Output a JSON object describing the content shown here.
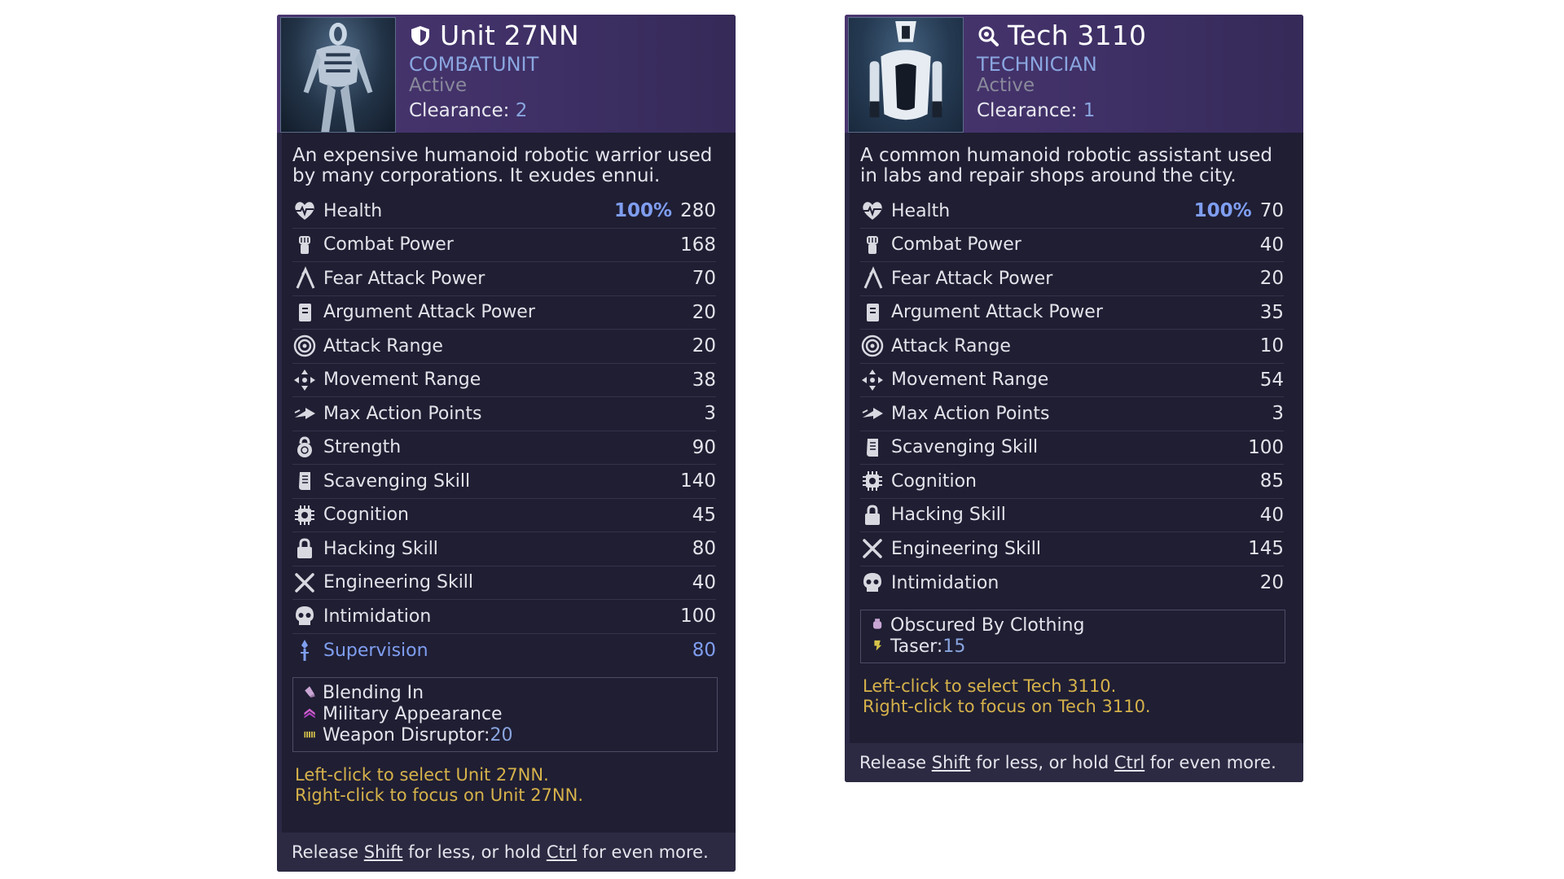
{
  "cards": [
    {
      "title": "Unit 27NN",
      "title_icon": "shield-icon",
      "class": "COMBATUNIT",
      "status": "Active",
      "clearance_label": "Clearance: ",
      "clearance_value": "2",
      "description": "An expensive humanoid robotic warrior used by many corporations. It exudes ennui.",
      "stats": [
        {
          "icon": "heartbeat-icon",
          "label": "Health",
          "pct": "100%",
          "value": "280"
        },
        {
          "icon": "fist-icon",
          "label": "Combat Power",
          "value": "168"
        },
        {
          "icon": "claw-icon",
          "label": "Fear Attack Power",
          "value": "70"
        },
        {
          "icon": "book-icon",
          "label": "Argument Attack Power",
          "value": "20"
        },
        {
          "icon": "target-icon",
          "label": "Attack Range",
          "value": "20"
        },
        {
          "icon": "move-arrows-icon",
          "label": "Movement Range",
          "value": "38"
        },
        {
          "icon": "fast-arrow-icon",
          "label": "Max Action Points",
          "value": "3"
        },
        {
          "icon": "kettlebell-icon",
          "label": "Strength",
          "value": "90"
        },
        {
          "icon": "scroll-icon",
          "label": "Scavenging Skill",
          "value": "140"
        },
        {
          "icon": "chip-icon",
          "label": "Cognition",
          "value": "45"
        },
        {
          "icon": "padlock-icon",
          "label": "Hacking Skill",
          "value": "80"
        },
        {
          "icon": "crossed-tools-icon",
          "label": "Engineering Skill",
          "value": "40"
        },
        {
          "icon": "skull-icon",
          "label": "Intimidation",
          "value": "100"
        },
        {
          "icon": "scepter-icon",
          "label": "Supervision",
          "value": "80",
          "special": true
        }
      ],
      "traits": [
        {
          "icon": "blend-icon",
          "label": "Blending In",
          "value": ""
        },
        {
          "icon": "chevron-rank-icon",
          "label": "Military Appearance",
          "value": ""
        },
        {
          "icon": "disruptor-icon",
          "label": "Weapon Disruptor: ",
          "value": "20"
        }
      ],
      "hint_select": "Left-click to select Unit 27NN.",
      "hint_focus": "Right-click to focus on Unit 27NN.",
      "footer": {
        "pre": "Release ",
        "key1": "Shift",
        "mid": " for less, or hold ",
        "key2": "Ctrl",
        "post": " for even more."
      }
    },
    {
      "title": "Tech 3110",
      "title_icon": "magnifier-gear-icon",
      "class": "TECHNICIAN",
      "status": "Active",
      "clearance_label": "Clearance: ",
      "clearance_value": "1",
      "description": "A common humanoid robotic assistant used in labs and repair shops around the city.",
      "stats": [
        {
          "icon": "heartbeat-icon",
          "label": "Health",
          "pct": "100%",
          "value": "70"
        },
        {
          "icon": "fist-icon",
          "label": "Combat Power",
          "value": "40"
        },
        {
          "icon": "claw-icon",
          "label": "Fear Attack Power",
          "value": "20"
        },
        {
          "icon": "book-icon",
          "label": "Argument Attack Power",
          "value": "35"
        },
        {
          "icon": "target-icon",
          "label": "Attack Range",
          "value": "10"
        },
        {
          "icon": "move-arrows-icon",
          "label": "Movement Range",
          "value": "54"
        },
        {
          "icon": "fast-arrow-icon",
          "label": "Max Action Points",
          "value": "3"
        },
        {
          "icon": "scroll-icon",
          "label": "Scavenging Skill",
          "value": "100"
        },
        {
          "icon": "chip-icon",
          "label": "Cognition",
          "value": "85"
        },
        {
          "icon": "padlock-icon",
          "label": "Hacking Skill",
          "value": "40"
        },
        {
          "icon": "crossed-tools-icon",
          "label": "Engineering Skill",
          "value": "145"
        },
        {
          "icon": "skull-icon",
          "label": "Intimidation",
          "value": "20"
        }
      ],
      "traits": [
        {
          "icon": "jar-icon",
          "label": "Obscured By Clothing",
          "value": ""
        },
        {
          "icon": "taser-icon",
          "label": "Taser: ",
          "value": "15"
        }
      ],
      "hint_select": "Left-click to select Tech 3110.",
      "hint_focus": "Right-click to focus on Tech 3110.",
      "footer": {
        "pre": "Release ",
        "key1": "Shift",
        "mid": " for less, or hold ",
        "key2": "Ctrl",
        "post": " for even more."
      }
    }
  ]
}
